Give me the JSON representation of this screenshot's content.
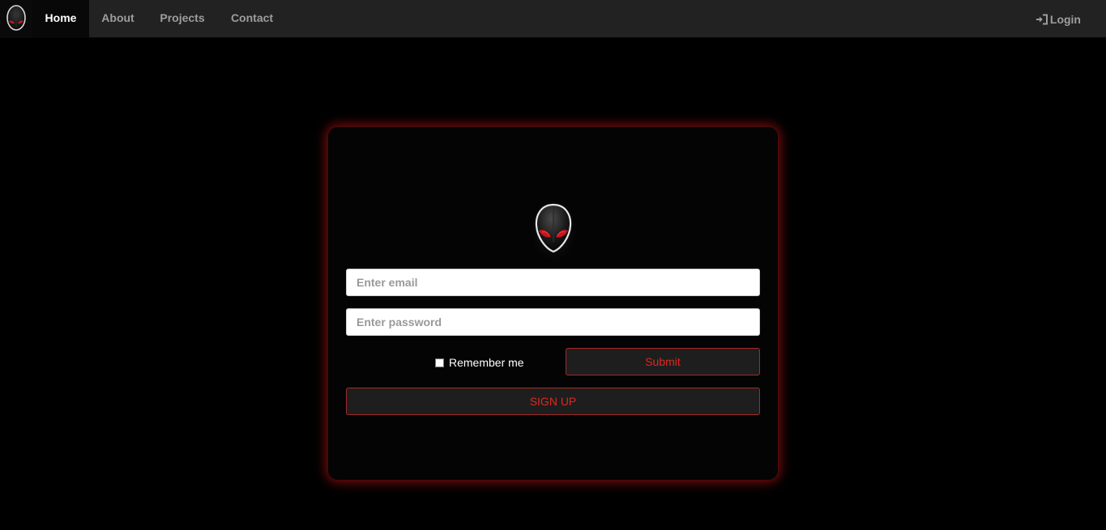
{
  "nav": {
    "brand_icon": "alien-head-icon",
    "items": [
      {
        "label": "Home",
        "active": true
      },
      {
        "label": "About",
        "active": false
      },
      {
        "label": "Projects",
        "active": false
      },
      {
        "label": "Contact",
        "active": false
      }
    ],
    "login_label": "Login",
    "login_icon": "log-in-icon"
  },
  "login_form": {
    "logo_icon": "alien-head-icon",
    "email_placeholder": "Enter email",
    "email_value": "",
    "password_placeholder": "Enter password",
    "password_value": "",
    "remember_label": "Remember me",
    "remember_checked": false,
    "submit_label": "Submit",
    "signup_label": "SIGN UP"
  },
  "colors": {
    "background": "#000000",
    "navbar": "#222222",
    "accent_red": "#e0281e",
    "card_glow": "#be1414"
  }
}
